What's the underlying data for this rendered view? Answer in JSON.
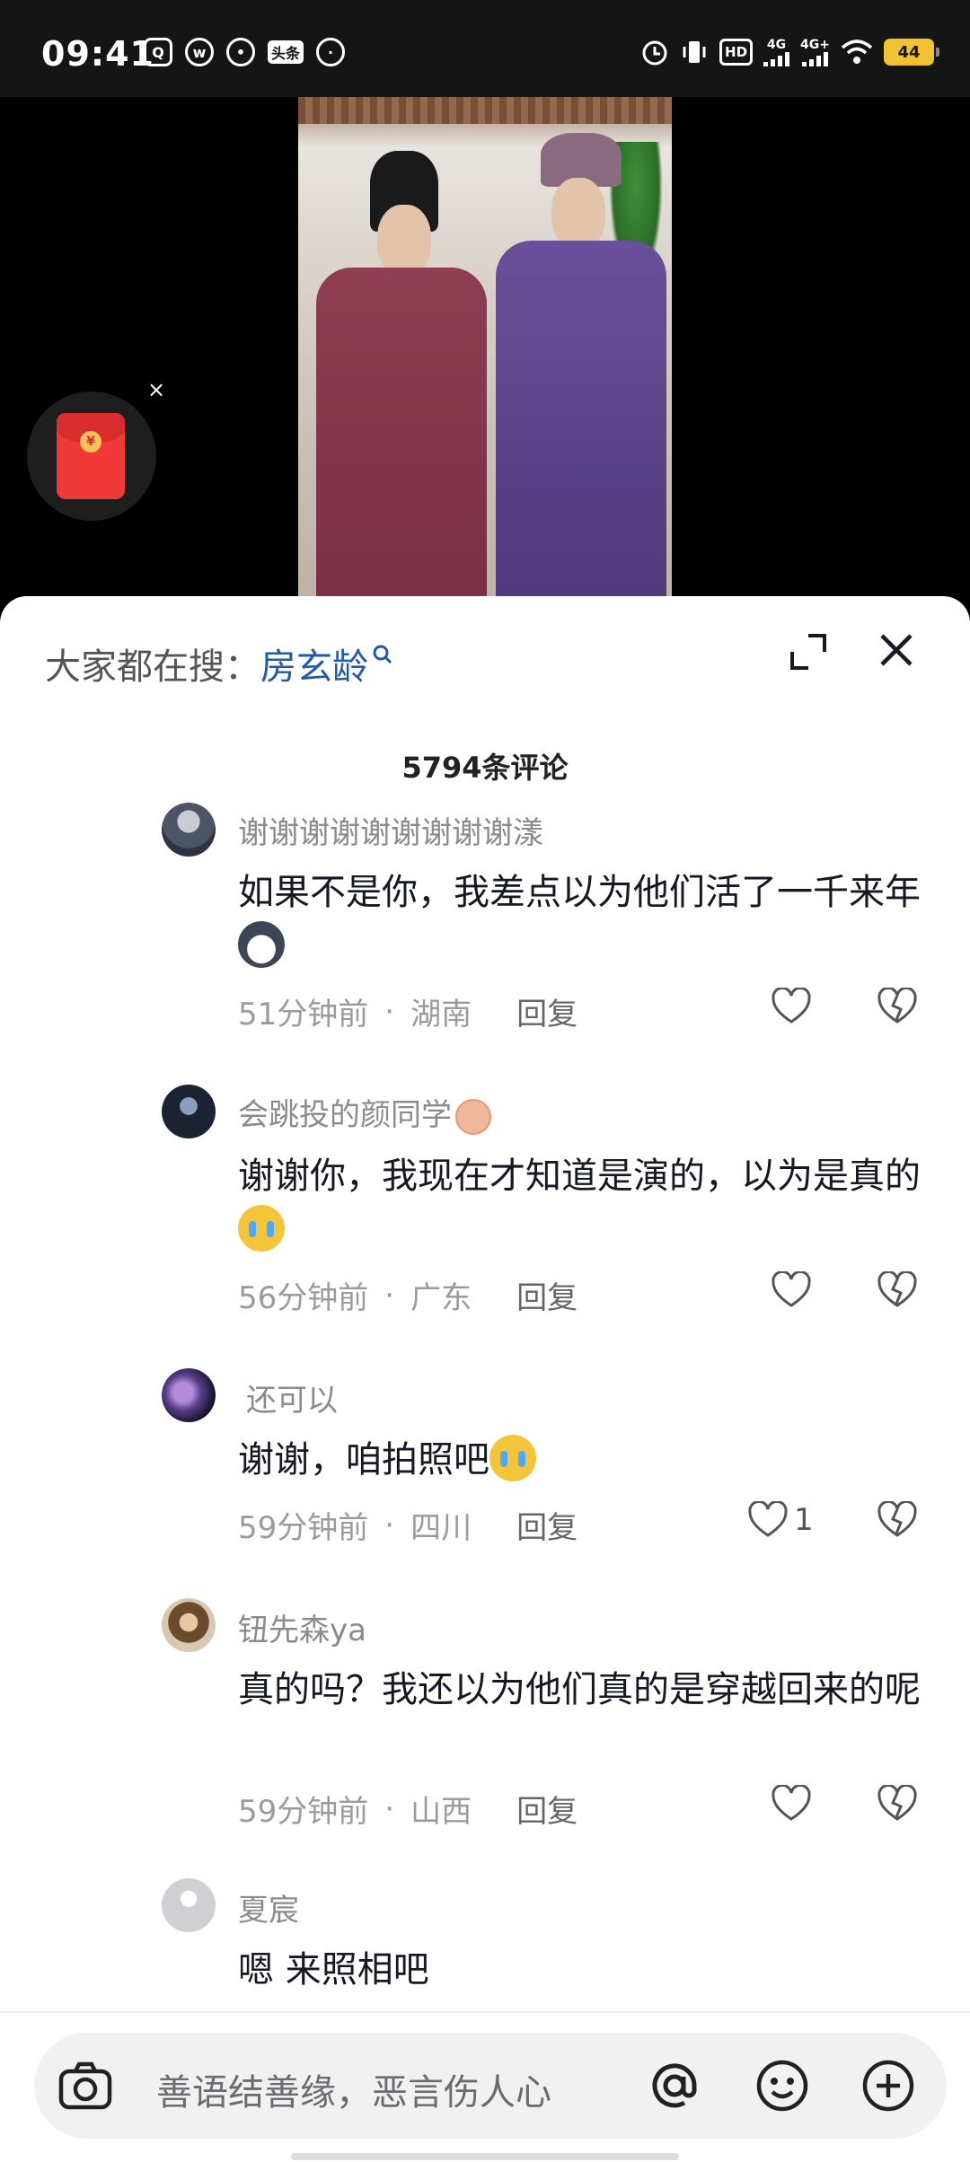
{
  "status_bar": {
    "time": "09:41",
    "battery": "44",
    "network_1": "4G",
    "network_2": "4G+",
    "hd_label": "HD",
    "left_app_icons": [
      "qq-browser-icon",
      "weibo-icon",
      "wechat-icon",
      "toutiao-icon",
      "location-icon"
    ],
    "toutiao_label": "头条"
  },
  "red_packet": {
    "symbol": "¥",
    "close": "×"
  },
  "sheet": {
    "search_prefix": "大家都在搜：",
    "search_term": "房玄龄",
    "comment_count": "5794条评论"
  },
  "comments": [
    {
      "user": "谢谢谢谢谢谢谢谢谢漾",
      "text": "如果不是你，我差点以为他们活了一千来年",
      "time": "51分钟前",
      "location": "湖南",
      "reply": "回复",
      "likes": ""
    },
    {
      "user": "会跳投的颜同学",
      "text": "谢谢你，我现在才知道是演的，以为是真的",
      "time": "56分钟前",
      "location": "广东",
      "reply": "回复",
      "likes": ""
    },
    {
      "user": "还可以",
      "text": "谢谢，咱拍照吧",
      "time": "59分钟前",
      "location": "四川",
      "reply": "回复",
      "likes": "1"
    },
    {
      "user": "钮先森ya",
      "text": "真的吗？我还以为他们真的是穿越回来的呢",
      "time": "59分钟前",
      "location": "山西",
      "reply": "回复",
      "likes": ""
    },
    {
      "user": "夏宸",
      "text": "嗯 来照相吧"
    }
  ],
  "input_bar": {
    "placeholder": "善语结善缘，恶言伤人心"
  },
  "colors": {
    "link": "#1f5aa6",
    "sheet_bg": "#ffffff",
    "muted": "#8a8a8f",
    "battery": "#f2c230"
  }
}
